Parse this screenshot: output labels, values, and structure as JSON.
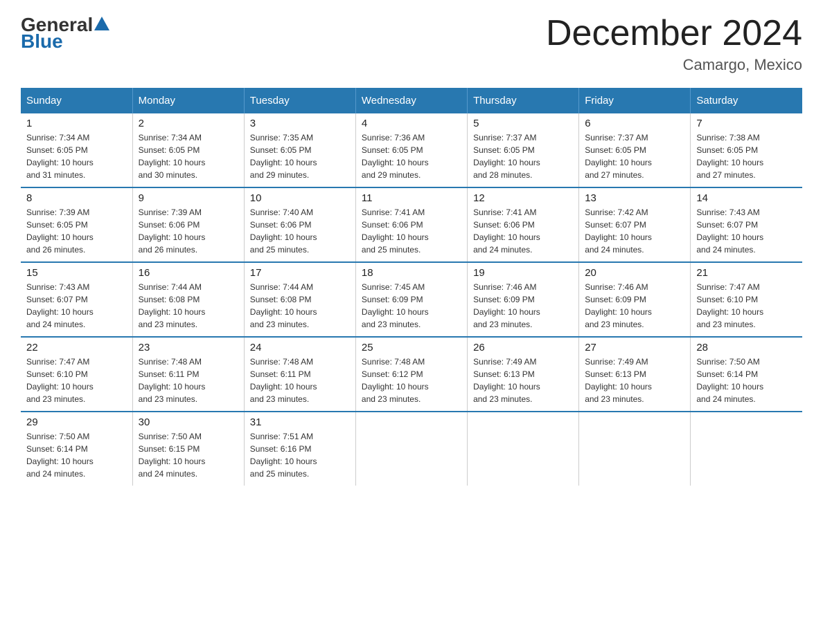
{
  "logo": {
    "text_general": "General",
    "triangle": "▲",
    "text_blue": "Blue"
  },
  "header": {
    "title": "December 2024",
    "subtitle": "Camargo, Mexico"
  },
  "weekdays": [
    "Sunday",
    "Monday",
    "Tuesday",
    "Wednesday",
    "Thursday",
    "Friday",
    "Saturday"
  ],
  "weeks": [
    [
      {
        "day": "1",
        "sunrise": "7:34 AM",
        "sunset": "6:05 PM",
        "daylight": "10 hours and 31 minutes."
      },
      {
        "day": "2",
        "sunrise": "7:34 AM",
        "sunset": "6:05 PM",
        "daylight": "10 hours and 30 minutes."
      },
      {
        "day": "3",
        "sunrise": "7:35 AM",
        "sunset": "6:05 PM",
        "daylight": "10 hours and 29 minutes."
      },
      {
        "day": "4",
        "sunrise": "7:36 AM",
        "sunset": "6:05 PM",
        "daylight": "10 hours and 29 minutes."
      },
      {
        "day": "5",
        "sunrise": "7:37 AM",
        "sunset": "6:05 PM",
        "daylight": "10 hours and 28 minutes."
      },
      {
        "day": "6",
        "sunrise": "7:37 AM",
        "sunset": "6:05 PM",
        "daylight": "10 hours and 27 minutes."
      },
      {
        "day": "7",
        "sunrise": "7:38 AM",
        "sunset": "6:05 PM",
        "daylight": "10 hours and 27 minutes."
      }
    ],
    [
      {
        "day": "8",
        "sunrise": "7:39 AM",
        "sunset": "6:05 PM",
        "daylight": "10 hours and 26 minutes."
      },
      {
        "day": "9",
        "sunrise": "7:39 AM",
        "sunset": "6:06 PM",
        "daylight": "10 hours and 26 minutes."
      },
      {
        "day": "10",
        "sunrise": "7:40 AM",
        "sunset": "6:06 PM",
        "daylight": "10 hours and 25 minutes."
      },
      {
        "day": "11",
        "sunrise": "7:41 AM",
        "sunset": "6:06 PM",
        "daylight": "10 hours and 25 minutes."
      },
      {
        "day": "12",
        "sunrise": "7:41 AM",
        "sunset": "6:06 PM",
        "daylight": "10 hours and 24 minutes."
      },
      {
        "day": "13",
        "sunrise": "7:42 AM",
        "sunset": "6:07 PM",
        "daylight": "10 hours and 24 minutes."
      },
      {
        "day": "14",
        "sunrise": "7:43 AM",
        "sunset": "6:07 PM",
        "daylight": "10 hours and 24 minutes."
      }
    ],
    [
      {
        "day": "15",
        "sunrise": "7:43 AM",
        "sunset": "6:07 PM",
        "daylight": "10 hours and 24 minutes."
      },
      {
        "day": "16",
        "sunrise": "7:44 AM",
        "sunset": "6:08 PM",
        "daylight": "10 hours and 23 minutes."
      },
      {
        "day": "17",
        "sunrise": "7:44 AM",
        "sunset": "6:08 PM",
        "daylight": "10 hours and 23 minutes."
      },
      {
        "day": "18",
        "sunrise": "7:45 AM",
        "sunset": "6:09 PM",
        "daylight": "10 hours and 23 minutes."
      },
      {
        "day": "19",
        "sunrise": "7:46 AM",
        "sunset": "6:09 PM",
        "daylight": "10 hours and 23 minutes."
      },
      {
        "day": "20",
        "sunrise": "7:46 AM",
        "sunset": "6:09 PM",
        "daylight": "10 hours and 23 minutes."
      },
      {
        "day": "21",
        "sunrise": "7:47 AM",
        "sunset": "6:10 PM",
        "daylight": "10 hours and 23 minutes."
      }
    ],
    [
      {
        "day": "22",
        "sunrise": "7:47 AM",
        "sunset": "6:10 PM",
        "daylight": "10 hours and 23 minutes."
      },
      {
        "day": "23",
        "sunrise": "7:48 AM",
        "sunset": "6:11 PM",
        "daylight": "10 hours and 23 minutes."
      },
      {
        "day": "24",
        "sunrise": "7:48 AM",
        "sunset": "6:11 PM",
        "daylight": "10 hours and 23 minutes."
      },
      {
        "day": "25",
        "sunrise": "7:48 AM",
        "sunset": "6:12 PM",
        "daylight": "10 hours and 23 minutes."
      },
      {
        "day": "26",
        "sunrise": "7:49 AM",
        "sunset": "6:13 PM",
        "daylight": "10 hours and 23 minutes."
      },
      {
        "day": "27",
        "sunrise": "7:49 AM",
        "sunset": "6:13 PM",
        "daylight": "10 hours and 23 minutes."
      },
      {
        "day": "28",
        "sunrise": "7:50 AM",
        "sunset": "6:14 PM",
        "daylight": "10 hours and 24 minutes."
      }
    ],
    [
      {
        "day": "29",
        "sunrise": "7:50 AM",
        "sunset": "6:14 PM",
        "daylight": "10 hours and 24 minutes."
      },
      {
        "day": "30",
        "sunrise": "7:50 AM",
        "sunset": "6:15 PM",
        "daylight": "10 hours and 24 minutes."
      },
      {
        "day": "31",
        "sunrise": "7:51 AM",
        "sunset": "6:16 PM",
        "daylight": "10 hours and 25 minutes."
      },
      null,
      null,
      null,
      null
    ]
  ],
  "labels": {
    "sunrise": "Sunrise:",
    "sunset": "Sunset:",
    "daylight": "Daylight:"
  }
}
